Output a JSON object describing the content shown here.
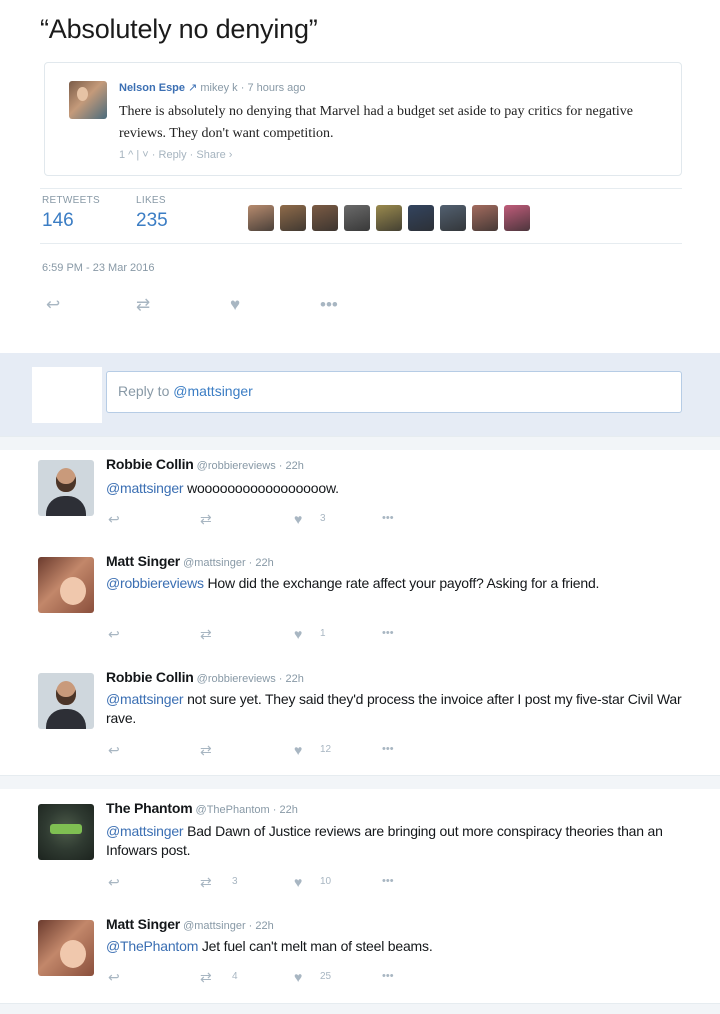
{
  "quote": "“Absolutely no denying”",
  "embed": {
    "name": "Nelson Espe",
    "reply_arrow": "↗",
    "reply_to": "mikey k",
    "time": "· 7 hours ago",
    "body": "There is absolutely no denying that Marvel had a budget set aside to pay critics for negative reviews. They don't want competition.",
    "actions": "1 ^ | ˅ · Reply · Share ›"
  },
  "stats": {
    "retweets_label": "RETWEETS",
    "retweets": "146",
    "likes_label": "LIKES",
    "likes": "235",
    "face_colors": [
      "#b78b6e",
      "#8f6b4a",
      "#7b5b44",
      "#6a6a6a",
      "#9a8a4e",
      "#33445f",
      "#526070",
      "#a36b5e",
      "#c05c7a"
    ]
  },
  "timestamp": "6:59 PM - 23 Mar 2016",
  "reply_box": {
    "prefix": "Reply to ",
    "handle": "@mattsinger"
  },
  "threads": [
    {
      "tweets": [
        {
          "name": "Robbie Collin",
          "meta": "@robbiereviews · 22h",
          "mention": "@mattsinger",
          "text": " wooooooooooooooooow.",
          "retweets": "",
          "likes": "3",
          "avatar": "robbie"
        },
        {
          "name": "Matt Singer",
          "meta": "@mattsinger · 22h",
          "mention": "@robbiereviews",
          "text": " How did the exchange rate affect your payoff? Asking for a friend.",
          "retweets": "",
          "likes": "1",
          "avatar": "matt"
        },
        {
          "name": "Robbie Collin",
          "meta": "@robbiereviews · 22h",
          "mention": "@mattsinger",
          "text": " not sure yet. They said they'd process the invoice after I post my five-star Civil War rave.",
          "retweets": "",
          "likes": "12",
          "avatar": "robbie"
        }
      ]
    },
    {
      "tweets": [
        {
          "name": "The Phantom",
          "meta": "@ThePhantom · 22h",
          "mention": "@mattsinger",
          "text": " Bad Dawn of Justice reviews are bringing out more conspiracy theories than an Infowars post.",
          "retweets": "3",
          "likes": "10",
          "avatar": "phantom"
        },
        {
          "name": "Matt Singer",
          "meta": "@mattsinger · 22h",
          "mention": "@ThePhantom",
          "text": " Jet fuel can't melt man of steel beams.",
          "retweets": "4",
          "likes": "25",
          "avatar": "matt"
        }
      ]
    }
  ],
  "icons": {
    "reply": "reply-arrow",
    "retweet": "retweet-arrows",
    "like": "heart",
    "more": "ellipsis"
  }
}
